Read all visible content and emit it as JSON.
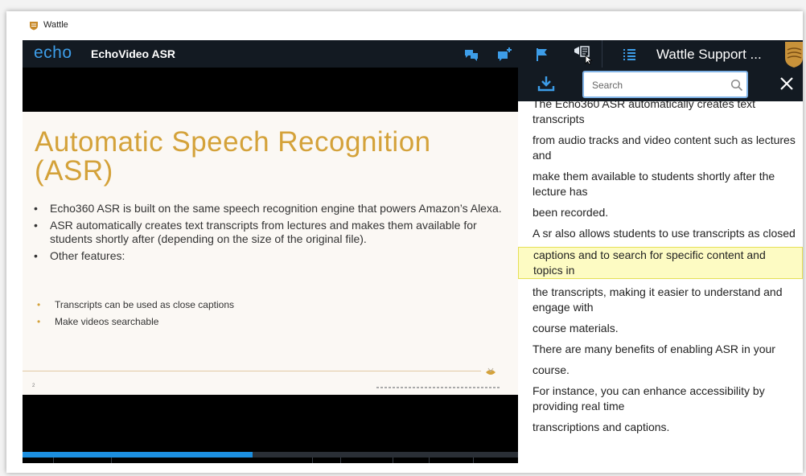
{
  "window": {
    "title": "Wattle"
  },
  "navbar": {
    "logo": "echo",
    "title": "EchoVideo ASR",
    "support_label": "Wattle Support ...",
    "icons": [
      "chat-icon",
      "add-comment-icon",
      "flag-icon",
      "transcript-icon",
      "list-icon",
      "crest-icon"
    ]
  },
  "slide": {
    "title_line1": "Automatic Speech Recognition",
    "title_line2": "(ASR)",
    "bullets": [
      "Echo360 ASR is built on the same speech recognition engine that powers Amazon’s Alexa.",
      "ASR automatically creates text transcripts from lectures and makes them available for students shortly after (depending on the size of the original file).",
      "Other features:"
    ],
    "sub_bullets": [
      "Transcripts can be used as close captions",
      "Make videos searchable"
    ],
    "page_number": "2"
  },
  "player": {
    "progress": 0.465
  },
  "panel": {
    "search_placeholder": "Search",
    "segments": [
      "The Echo360 ASR automatically creates text transcripts",
      "from audio tracks and video content such as lectures and",
      "make them available to students shortly after the lecture has",
      "been recorded.",
      "A sr also allows students to use transcripts as closed",
      "captions and to search for specific content and topics in",
      "the transcripts, making it easier to understand and engage with",
      "course materials.",
      "There are many benefits of enabling ASR in your",
      "course.",
      "For instance, you can enhance accessibility by providing real time",
      "transcriptions and captions."
    ],
    "highlighted_index": 5
  },
  "colors": {
    "accent": "#1c8fe0",
    "title_gold": "#d4a23a",
    "navbar": "#131a22",
    "highlight": "#fdfbc3"
  }
}
